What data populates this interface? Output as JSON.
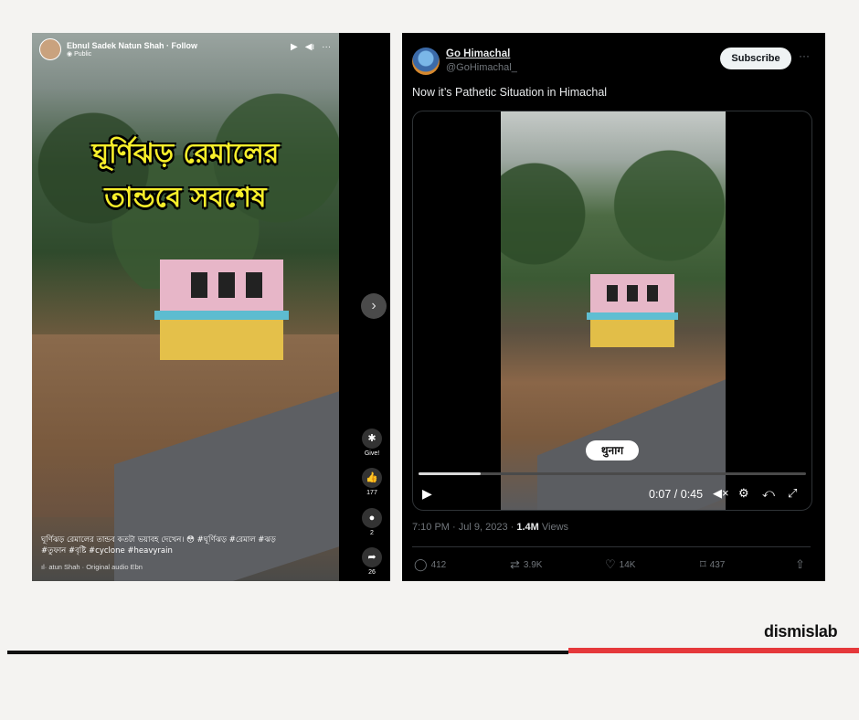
{
  "facebook": {
    "author": "Ebnul Sadek Natun Shah",
    "follow": "Follow",
    "header_line": "Ebnul Sadek Natun Shah · Follow",
    "privacy": "Public",
    "banner_line1": "ঘূর্ণিঝড় রেমালের",
    "banner_line2": "তান্ডবে সবশেষ",
    "caption_line1": "ঘূর্ণিঝড় রেমালের তান্ডব কতটা ভয়াবহ দেখেন। 😳 #ঘূর্ণিঝড় #রেমাল #ঝড়",
    "caption_line2": "#তুফান #বৃষ্টি #cyclone #heavyrain",
    "audio": "atun Shah · Original audio      Ebn",
    "give_label": "Give!",
    "likes": "177",
    "comments": "2",
    "shares": "26",
    "icons": [
      "play-icon",
      "volume-icon",
      "more-icon",
      "next-icon",
      "gift-icon",
      "like-icon",
      "comment-icon",
      "share-icon",
      "audio-icon"
    ]
  },
  "twitter": {
    "name": "Go Himachal",
    "handle": "@GoHimachal_",
    "subscribe": "Subscribe",
    "more": "···",
    "text": "Now it’s Pathetic Situation in Himachal",
    "chip": "थुनाग",
    "time": "0:07 / 0:45",
    "progress": 0.16,
    "meta_prefix": "7:10 PM · Jul 9, 2023 · ",
    "views_count": "1.4M",
    "views_label": " Views",
    "replies": "412",
    "reposts": "3.9K",
    "likes": "14K",
    "bookmarks": "437"
  },
  "brand": "dismislab",
  "colors": {
    "accent_red": "#e5383b",
    "banner_yellow": "#f7ee2a"
  }
}
